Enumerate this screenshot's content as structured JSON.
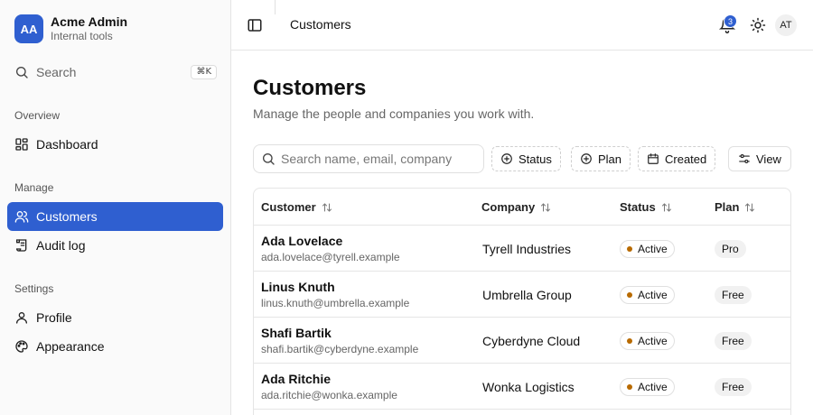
{
  "brand": {
    "initials": "AA",
    "name": "Acme Admin",
    "subtitle": "Internal tools"
  },
  "sidebar": {
    "search_label": "Search",
    "search_shortcut": "⌘K",
    "sections": [
      {
        "label": "Overview",
        "items": [
          {
            "label": "Dashboard",
            "icon": "dashboard-icon"
          }
        ]
      },
      {
        "label": "Manage",
        "items": [
          {
            "label": "Customers",
            "icon": "users-icon",
            "active": true
          },
          {
            "label": "Audit log",
            "icon": "scroll-icon"
          }
        ]
      },
      {
        "label": "Settings",
        "items": [
          {
            "label": "Profile",
            "icon": "user-icon"
          },
          {
            "label": "Appearance",
            "icon": "palette-icon"
          }
        ]
      }
    ]
  },
  "topbar": {
    "title": "Customers",
    "notification_count": "3",
    "user_initials": "AT"
  },
  "main": {
    "title": "Customers",
    "description": "Manage the people and companies you work with.",
    "search_placeholder": "Search name, email, company",
    "filters": {
      "status": "Status",
      "plan": "Plan",
      "created": "Created",
      "view": "View"
    }
  },
  "table": {
    "columns": [
      "Customer",
      "Company",
      "Status",
      "Plan"
    ],
    "rows": [
      {
        "name": "Ada Lovelace",
        "email": "ada.lovelace@tyrell.example",
        "company": "Tyrell Industries",
        "status": "Active",
        "plan": "Pro"
      },
      {
        "name": "Linus Knuth",
        "email": "linus.knuth@umbrella.example",
        "company": "Umbrella Group",
        "status": "Active",
        "plan": "Free"
      },
      {
        "name": "Shafi Bartik",
        "email": "shafi.bartik@cyberdyne.example",
        "company": "Cyberdyne Cloud",
        "status": "Active",
        "plan": "Free"
      },
      {
        "name": "Ada Ritchie",
        "email": "ada.ritchie@wonka.example",
        "company": "Wonka Logistics",
        "status": "Active",
        "plan": "Free"
      }
    ]
  },
  "colors": {
    "accent": "#2f5fd0",
    "status_active_dot": "#b86a00"
  }
}
